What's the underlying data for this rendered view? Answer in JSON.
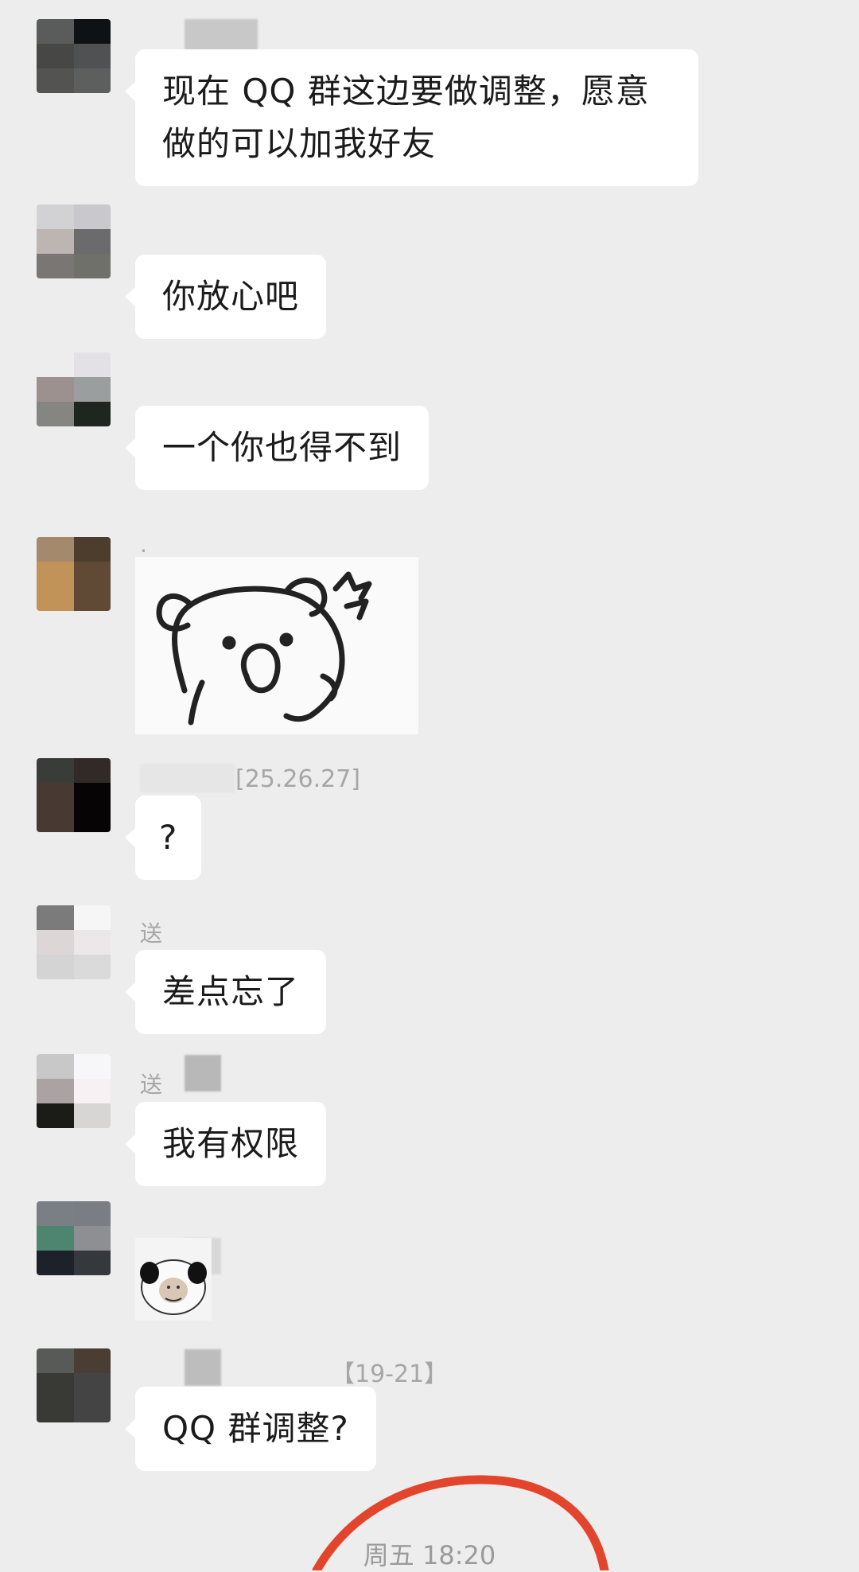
{
  "messages": [
    {
      "sender": "",
      "text": "现在 QQ 群这边要做调整，愿意做的可以加我好友",
      "type": "text"
    },
    {
      "sender": "",
      "text": "你放心吧",
      "type": "text"
    },
    {
      "sender": "",
      "text": "一个你也得不到",
      "type": "text"
    },
    {
      "sender": ".",
      "text": "",
      "type": "sticker",
      "sticker": "surprised-bear-sticker"
    },
    {
      "sender": "[25.26.27]",
      "text": "?",
      "type": "text"
    },
    {
      "sender": "送",
      "text": "差点忘了",
      "type": "text"
    },
    {
      "sender": "送",
      "text": "我有权限",
      "type": "text"
    },
    {
      "sender": "",
      "text": "",
      "type": "sticker",
      "sticker": "panda-face-sticker"
    },
    {
      "sender": "【19-21】",
      "text": "QQ 群调整?",
      "type": "text"
    }
  ],
  "timestamp": "周五 18:20",
  "colors": {
    "background": "#ededed",
    "bubble": "#ffffff",
    "annotation": "#e2452c"
  }
}
